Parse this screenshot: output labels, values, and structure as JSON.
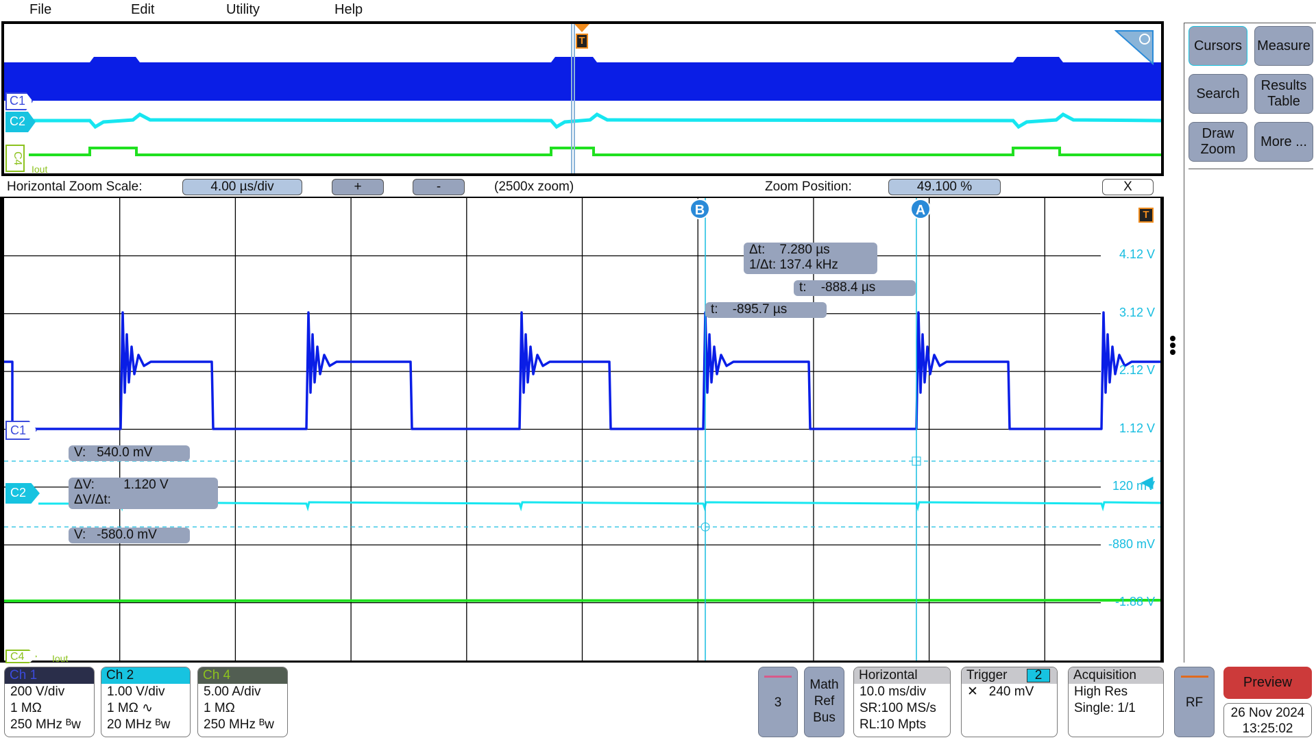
{
  "menu": [
    "File",
    "Edit",
    "Utility",
    "Help"
  ],
  "overview": {
    "ch_labels": {
      "c1": "C1",
      "c2": "C2",
      "c4": "C4"
    },
    "c4_name": "Iout",
    "trigger": "T"
  },
  "zoom_bar": {
    "scale_label": "Horizontal Zoom Scale:",
    "scale_value": "4.00 µs/div",
    "plus": "+",
    "minus": "-",
    "zoom_factor": "(2500x zoom)",
    "position_label": "Zoom Position:",
    "position_value": "49.100 %",
    "close": "X"
  },
  "plot": {
    "cursor_a": "A",
    "cursor_b": "B",
    "trigger": "T",
    "ch_labels": {
      "c1": "C1",
      "c2": "C2",
      "c4": "C4"
    },
    "c4_name": "Iout",
    "volt_labels": [
      "4.12 V",
      "3.12 V",
      "2.12 V",
      "1.12 V",
      "120 mV",
      "-880 mV",
      "-1.88 V"
    ],
    "readouts": {
      "dt_label": "Δt:",
      "dt_value": "7.280 µs",
      "inv_dt_label": "1/Δt:",
      "inv_dt_value": "137.4 kHz",
      "ta_label": "t:",
      "ta_value": "-888.4 µs",
      "tb_label": "t:",
      "tb_value": "-895.7 µs",
      "va_label": "V:",
      "va_value": "540.0 mV",
      "dv_label": "ΔV:",
      "dv_value": "1.120 V",
      "dvdt_label": "ΔV/Δt:",
      "vb_label": "V:",
      "vb_value": "-580.0 mV"
    },
    "colors": {
      "c1": "#0a1ee6",
      "c2": "#17e6f0",
      "c4": "#20e020",
      "cursor": "#17bde0",
      "trigger": "#f08c1e"
    }
  },
  "sidebar": {
    "buttons": [
      "Cursors",
      "Measure",
      "Search",
      "Results Table",
      "Draw Zoom",
      "More ..."
    ]
  },
  "channels": [
    {
      "name": "Ch 1",
      "lines": [
        "200 V/div",
        "1 MΩ",
        "250 MHz ᴮw"
      ],
      "header_bg": "#2a2e4a",
      "header_fg": "#3b4bdc"
    },
    {
      "name": "Ch 2",
      "lines": [
        "1.00 V/div",
        "1 MΩ ∿",
        "20 MHz ᴮw"
      ],
      "header_bg": "#17c3e0",
      "header_fg": "#111"
    },
    {
      "name": "Ch 4",
      "lines": [
        "5.00 A/div",
        "1 MΩ",
        "250 MHz ᴮw"
      ],
      "header_bg": "#525e52",
      "header_fg": "#8cc21e"
    }
  ],
  "bottom": {
    "add_button": "3",
    "math_ref_bus": [
      "Math",
      "Ref",
      "Bus"
    ],
    "horizontal": {
      "title": "Horizontal",
      "lines": [
        "10.0 ms/div",
        "SR:100 MS/s",
        "RL:10 Mpts"
      ]
    },
    "trigger": {
      "title": "Trigger",
      "source": "2",
      "slope_icon": "edge-either-icon",
      "level": "240 mV"
    },
    "acquisition": {
      "title": "Acquisition",
      "lines": [
        "High Res",
        "Single: 1/1"
      ]
    },
    "rf": "RF",
    "preview": "Preview",
    "date": "26 Nov 2024",
    "time": "13:25:02"
  }
}
